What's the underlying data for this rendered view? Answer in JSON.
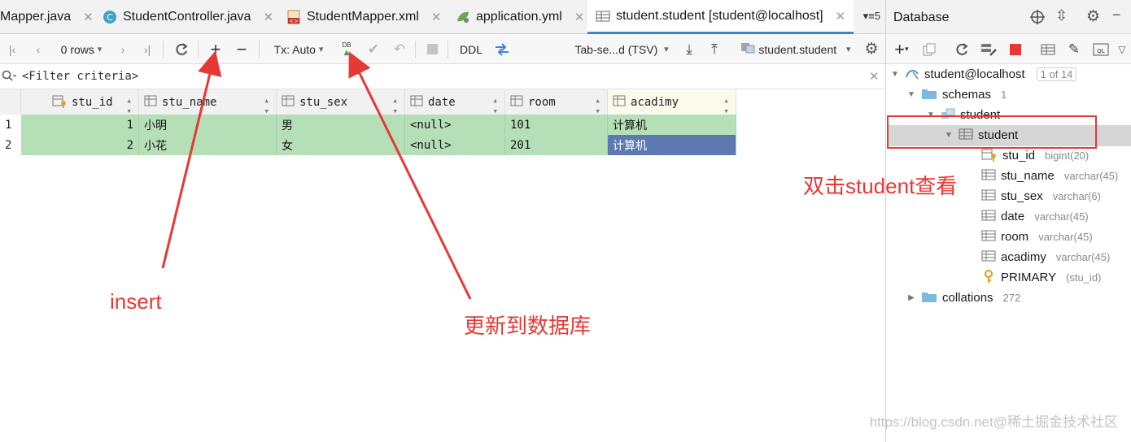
{
  "tabs": [
    {
      "label": "Mapper.java",
      "icon": "java-class-icon"
    },
    {
      "label": "StudentController.java",
      "icon": "class-c-icon"
    },
    {
      "label": "StudentMapper.xml",
      "icon": "xml-file-icon"
    },
    {
      "label": "application.yml",
      "icon": "spring-yml-icon"
    },
    {
      "label": "student.student [student@localhost]",
      "icon": "table-grid-icon"
    }
  ],
  "tab_overflow": "5",
  "toolbar": {
    "rows_label": "0 rows",
    "tx_label": "Tx: Auto",
    "db_label": "DB",
    "ddl_label": "DDL",
    "export_format": "Tab-se...d (TSV)",
    "table_ref": "student.student"
  },
  "filter": {
    "placeholder": "<Filter criteria>"
  },
  "grid": {
    "columns": [
      "stu_id",
      "stu_name",
      "stu_sex",
      "date",
      "room",
      "acadimy"
    ],
    "rows": [
      {
        "num": "1",
        "stu_id": "1",
        "stu_name": "小明",
        "stu_sex": "男",
        "date": "<null>",
        "room": "101",
        "acadimy": "计算机"
      },
      {
        "num": "2",
        "stu_id": "2",
        "stu_name": "小花",
        "stu_sex": "女",
        "date": "<null>",
        "room": "201",
        "acadimy": "计算机"
      }
    ]
  },
  "database": {
    "title": "Database",
    "connection": "student@localhost",
    "pager": "1 of 14",
    "schemas_label": "schemas",
    "schemas_count": "1",
    "schema_name": "student",
    "table_name": "student",
    "columns": [
      {
        "name": "stu_id",
        "type": "bigint(20)"
      },
      {
        "name": "stu_name",
        "type": "varchar(45)"
      },
      {
        "name": "stu_sex",
        "type": "varchar(6)"
      },
      {
        "name": "date",
        "type": "varchar(45)"
      },
      {
        "name": "room",
        "type": "varchar(45)"
      },
      {
        "name": "acadimy",
        "type": "varchar(45)"
      }
    ],
    "key_name": "PRIMARY",
    "key_cols": "(stu_id)",
    "collations_label": "collations",
    "collations_count": "272"
  },
  "annotations": {
    "insert": "insert",
    "update": "更新到数据库",
    "doubleclick": "双击student查看"
  },
  "watermark": "https://blog.csdn.net@稀土掘金技术社区",
  "colors": {
    "annotation": "#e53935",
    "row_green": "#b5dfb7",
    "row_selected": "#5c7ab1",
    "tab_accent": "#4083c9"
  }
}
